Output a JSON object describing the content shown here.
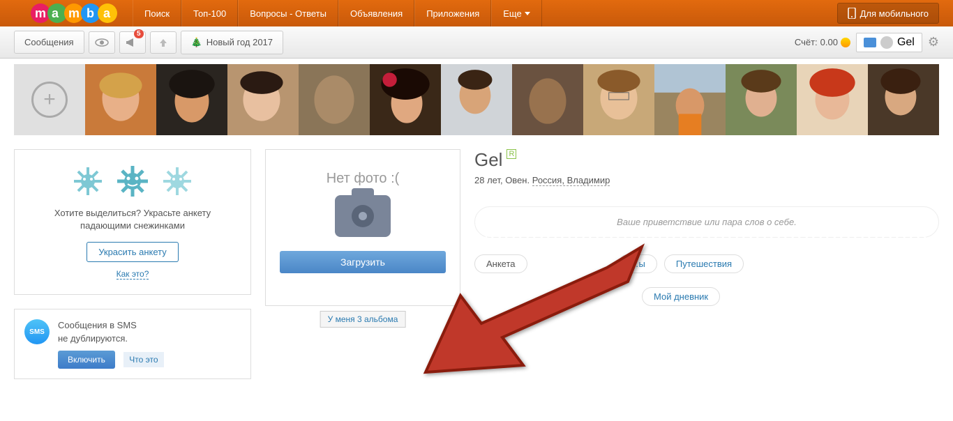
{
  "header": {
    "nav": {
      "search": "Поиск",
      "top100": "Топ-100",
      "qa": "Вопросы - Ответы",
      "ads": "Объявления",
      "apps": "Приложения",
      "more": "Еще"
    },
    "mobile": "Для мобильного"
  },
  "toolbar": {
    "messages": "Сообщения",
    "ny_badge": "5",
    "new_year": "Новый год 2017",
    "account_label": "Счёт:",
    "account_value": "0.00",
    "username": "Gel"
  },
  "promo": {
    "text": "Хотите выделиться? Украсьте анкету падающими снежинками",
    "button": "Украсить анкету",
    "link": "Как это?"
  },
  "sms": {
    "icon_label": "SMS",
    "line1": "Сообщения в SMS",
    "line2": "не дублируются.",
    "enable": "Включить",
    "what": "Что это"
  },
  "photo_card": {
    "no_photo": "Нет фото :(",
    "upload": "Загрузить",
    "albums": "У меня 3 альбома"
  },
  "profile": {
    "name": "Gel",
    "badge": "R",
    "meta_age": "28 лет, Овен.",
    "location": "Россия, Владимир",
    "greeting": "Ваше приветствие или пара слов о себе.",
    "tabs": {
      "anketa": "Анкета",
      "we": "…ы",
      "travel": "Путешествия",
      "diary": "Мой дневник"
    }
  }
}
